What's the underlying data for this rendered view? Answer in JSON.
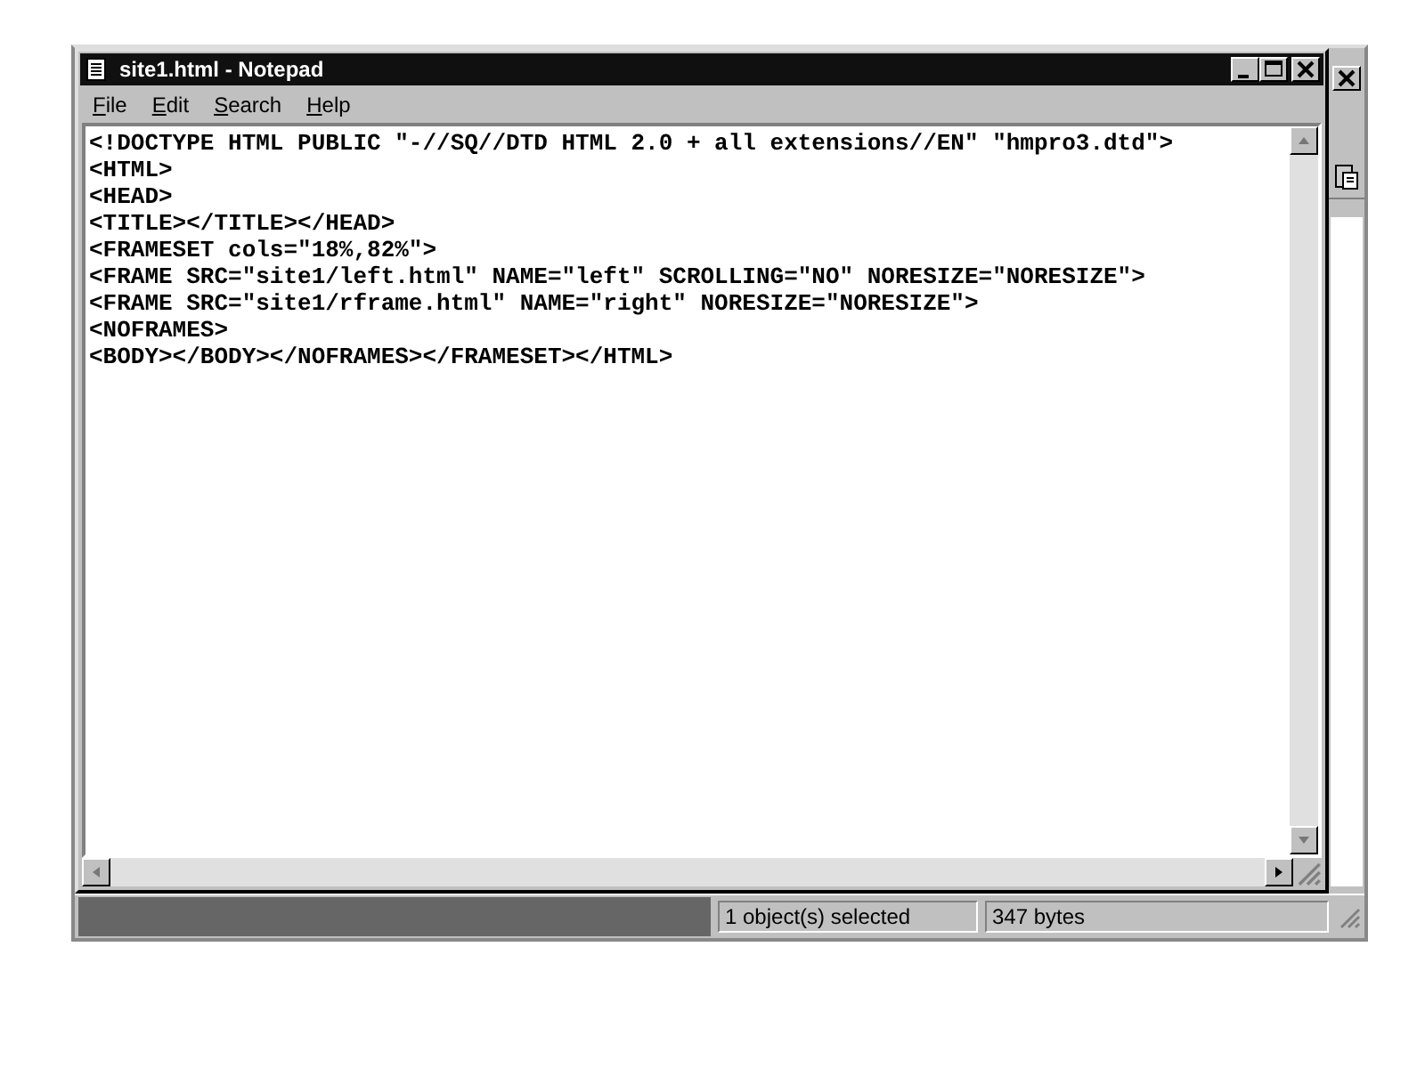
{
  "window": {
    "title": "site1.html - Notepad"
  },
  "menu": [
    {
      "label": "File"
    },
    {
      "label": "Edit"
    },
    {
      "label": "Search"
    },
    {
      "label": "Help"
    }
  ],
  "document": {
    "lines": [
      "<!DOCTYPE HTML PUBLIC \"-//SQ//DTD HTML 2.0 + all extensions//EN\" \"hmpro3.dtd\">",
      "<HTML>",
      "<HEAD>",
      "<TITLE></TITLE></HEAD>",
      "<FRAMESET cols=\"18%,82%\">",
      "<FRAME SRC=\"site1/left.html\" NAME=\"left\" SCROLLING=\"NO\" NORESIZE=\"NORESIZE\">",
      "<FRAME SRC=\"site1/rframe.html\" NAME=\"right\" NORESIZE=\"NORESIZE\">",
      "<NOFRAMES>",
      "<BODY></BODY></NOFRAMES></FRAMESET></HTML>"
    ]
  },
  "status_bar": [
    "1 object(s) selected",
    "347 bytes"
  ]
}
